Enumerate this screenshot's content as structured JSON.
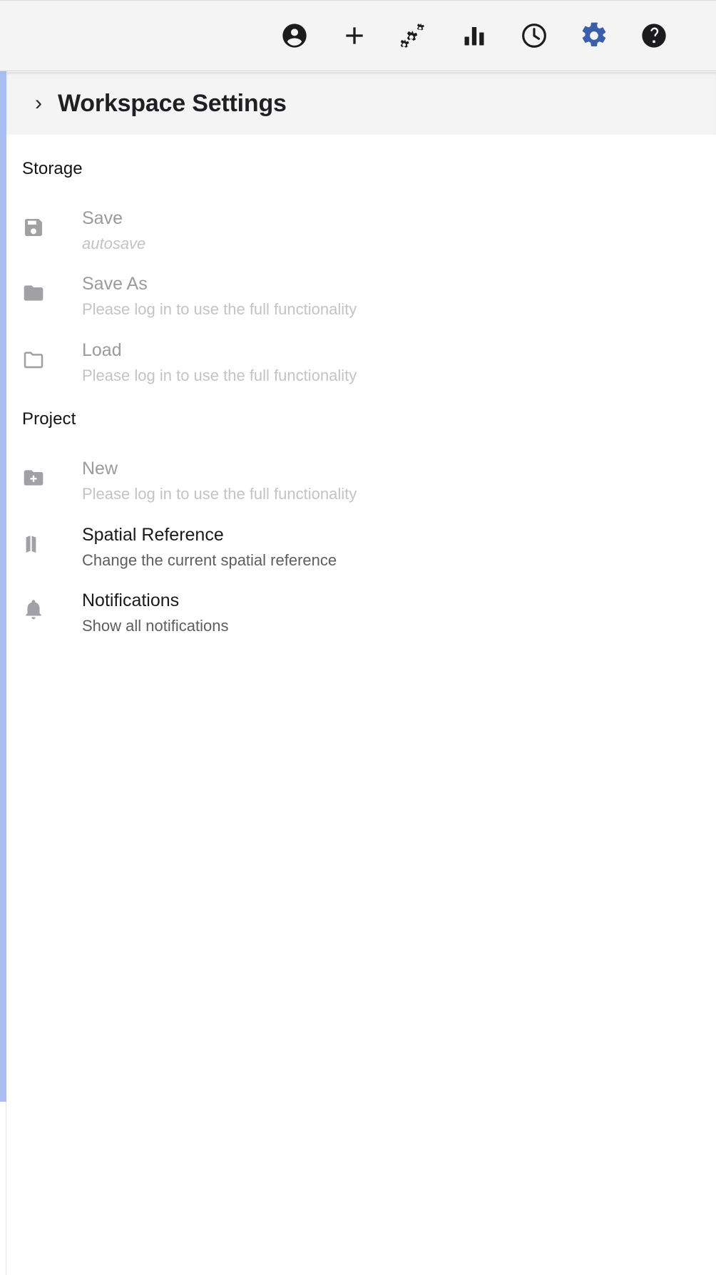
{
  "toolbar": {
    "buttons": [
      {
        "name": "account-icon",
        "label": "Account",
        "color": "#1c1c1f",
        "active": false
      },
      {
        "name": "add-icon",
        "label": "Add",
        "color": "#1c1c1f",
        "active": false
      },
      {
        "name": "processing-icon",
        "label": "Processing",
        "color": "#1c1c1f",
        "active": false
      },
      {
        "name": "statistics-icon",
        "label": "Statistics",
        "color": "#1c1c1f",
        "active": false
      },
      {
        "name": "history-icon",
        "label": "History",
        "color": "#1c1c1f",
        "active": false
      },
      {
        "name": "settings-gear-icon",
        "label": "Settings",
        "color": "#3b5ea8",
        "active": true
      },
      {
        "name": "help-icon",
        "label": "Help",
        "color": "#1c1c1f",
        "active": false
      }
    ]
  },
  "header": {
    "collapse_chevron": "›",
    "title": "Workspace Settings"
  },
  "sections": [
    {
      "title": "Storage",
      "items": [
        {
          "icon": "save-floppy-icon",
          "label": "Save",
          "sub": "autosave",
          "italic": true,
          "disabled": true
        },
        {
          "icon": "folder-filled-icon",
          "label": "Save As",
          "sub": "Please log in to use the full functionality",
          "italic": false,
          "disabled": true
        },
        {
          "icon": "folder-outline-icon",
          "label": "Load",
          "sub": "Please log in to use the full functionality",
          "italic": false,
          "disabled": true
        }
      ]
    },
    {
      "title": "Project",
      "items": [
        {
          "icon": "folder-plus-icon",
          "label": "New",
          "sub": "Please log in to use the full functionality",
          "italic": false,
          "disabled": true
        },
        {
          "icon": "map-icon",
          "label": "Spatial Reference",
          "sub": "Change the current spatial reference",
          "italic": false,
          "disabled": false
        },
        {
          "icon": "bell-icon",
          "label": "Notifications",
          "sub": "Show all notifications",
          "italic": false,
          "disabled": false
        }
      ]
    }
  ],
  "colors": {
    "accent": "#3b5ea8",
    "toolbar_bg": "#f4f4f5",
    "panel_bg": "#ffffff",
    "disabled_text": "#9a9a9f",
    "sliver": "#a8bdf0"
  }
}
